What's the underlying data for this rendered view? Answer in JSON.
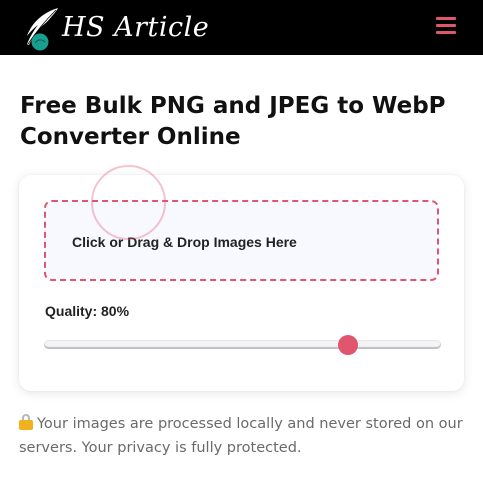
{
  "header": {
    "brand": "HS Article",
    "menu_icon": "hamburger-menu-icon"
  },
  "page": {
    "title": "Free Bulk PNG and JPEG to WebP Converter Online"
  },
  "converter": {
    "dropzone_label": "Click or Drag & Drop Images Here",
    "quality_label": "Quality: 80%",
    "quality_value": 80,
    "quality_min": 0,
    "quality_max": 100
  },
  "privacy": {
    "icon": "lock-icon",
    "text": "Your images are processed locally and never stored on our servers. Your privacy is fully protected."
  },
  "colors": {
    "accent": "#e0566f",
    "header_bg": "#000000",
    "logo_circle": "#1a9e8f"
  }
}
